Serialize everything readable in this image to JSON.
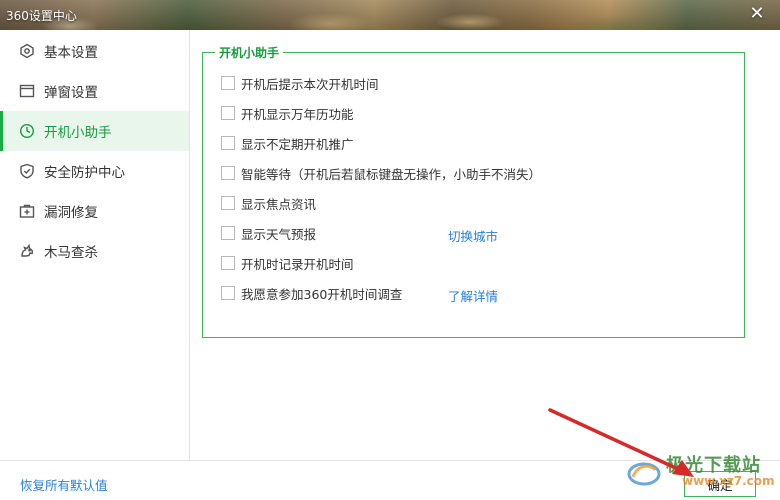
{
  "window": {
    "title": "360设置中心",
    "close_icon": "close-icon"
  },
  "sidebar": {
    "items": [
      {
        "label": "基本设置",
        "icon": "hexagon-gear-icon",
        "active": false
      },
      {
        "label": "弹窗设置",
        "icon": "window-icon",
        "active": false
      },
      {
        "label": "开机小助手",
        "icon": "clock-icon",
        "active": true
      },
      {
        "label": "安全防护中心",
        "icon": "shield-icon",
        "active": false
      },
      {
        "label": "漏洞修复",
        "icon": "medkit-icon",
        "active": false
      },
      {
        "label": "木马查杀",
        "icon": "horse-icon",
        "active": false
      }
    ]
  },
  "main": {
    "group_title": "开机小助手",
    "options": [
      {
        "label": "开机后提示本次开机时间",
        "checked": false
      },
      {
        "label": "开机显示万年历功能",
        "checked": false
      },
      {
        "label": "显示不定期开机推广",
        "checked": false
      },
      {
        "label": "智能等待（开机后若鼠标键盘无操作，小助手不消失）",
        "checked": false
      },
      {
        "label": "显示焦点资讯",
        "checked": false
      },
      {
        "label": "显示天气预报",
        "checked": false,
        "link": "切换城市"
      },
      {
        "label": "开机时记录开机时间",
        "checked": false
      },
      {
        "label": "我愿意参加360开机时间调查",
        "checked": false,
        "link": "了解详情"
      }
    ]
  },
  "footer": {
    "restore_defaults": "恢复所有默认值",
    "ok_button": "确定"
  },
  "watermark": {
    "text": "极光下载站",
    "sub": "www.xz7.com"
  },
  "colors": {
    "accent_green": "#1aad45",
    "link_blue": "#2a7ed8",
    "arrow_red": "#d42a2a"
  }
}
